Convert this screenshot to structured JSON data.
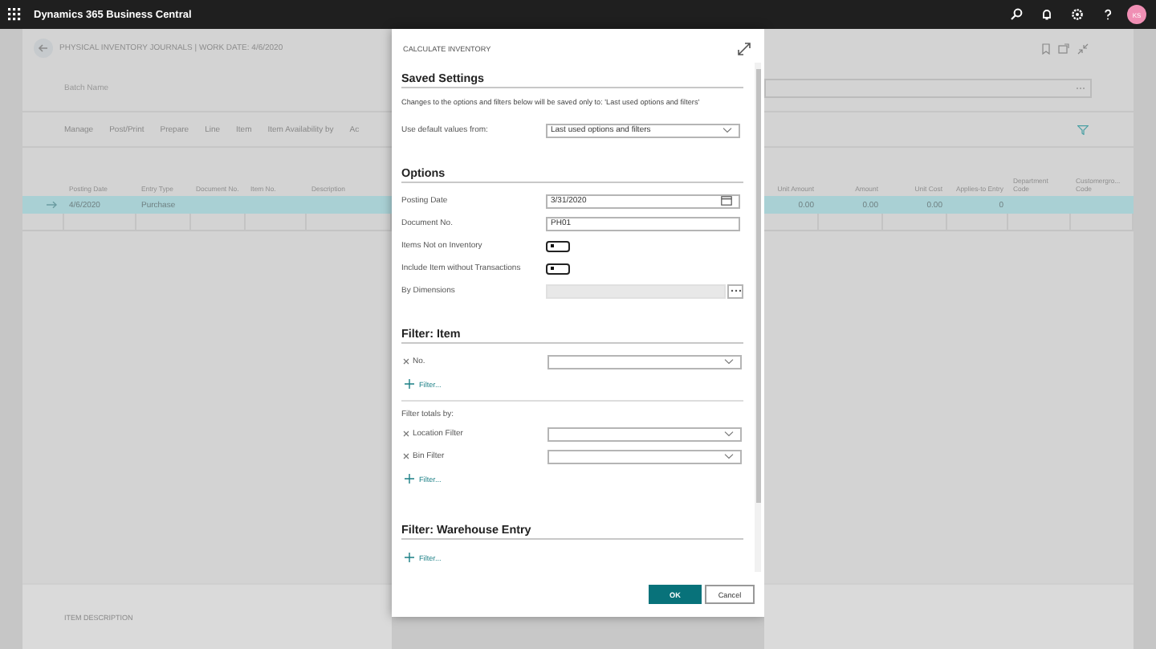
{
  "app": {
    "title": "Dynamics 365 Business Central",
    "avatar": "KS"
  },
  "page": {
    "title": "PHYSICAL INVENTORY JOURNALS | WORK DATE: 4/6/2020",
    "batch_label": "Batch Name",
    "actions": [
      "Manage",
      "Post/Print",
      "Prepare",
      "Line",
      "Item",
      "Item Availability by",
      "Ac"
    ],
    "columns_left": [
      "Posting Date",
      "Entry Type",
      "Document No.",
      "Item No.",
      "Description"
    ],
    "columns_right": [
      "Unit Amount",
      "Amount",
      "Unit Cost",
      "Applies-to Entry",
      "Department Code",
      "Customergro... Code"
    ],
    "rows": [
      {
        "selected": true,
        "posting_date": "4/6/2020",
        "entry_type": "Purchase",
        "unit_amount": "0.00",
        "amount": "0.00",
        "unit_cost": "0.00",
        "applies_to_entry": "0"
      }
    ],
    "factbox_title": "ITEM DESCRIPTION"
  },
  "dialog": {
    "title": "CALCULATE INVENTORY",
    "sections": [
      {
        "heading": "Saved Settings",
        "items": [
          {
            "kind": "note",
            "text": "Changes to the options and filters below will be saved only to: 'Last used options and filters'"
          },
          {
            "kind": "select",
            "label": "Use default values from:",
            "value": "Last used options and filters"
          }
        ]
      },
      {
        "heading": "Options",
        "items": [
          {
            "kind": "date",
            "label": "Posting Date",
            "value": "3/31/2020"
          },
          {
            "kind": "text",
            "label": "Document No.",
            "value": "PH01"
          },
          {
            "kind": "toggle",
            "label": "Items Not on Inventory",
            "on": false
          },
          {
            "kind": "toggle",
            "label": "Include Item without Transactions",
            "on": false
          },
          {
            "kind": "lookup",
            "label": "By Dimensions"
          }
        ]
      },
      {
        "heading": "Filter: Item",
        "items": [
          {
            "kind": "filter",
            "label": "No."
          },
          {
            "kind": "add_filter",
            "label": "Filter..."
          },
          {
            "kind": "subheading",
            "text": "Filter totals by:"
          },
          {
            "kind": "filter",
            "label": "Location Filter"
          },
          {
            "kind": "filter",
            "label": "Bin Filter"
          },
          {
            "kind": "add_filter",
            "label": "Filter..."
          }
        ]
      },
      {
        "heading": "Filter: Warehouse Entry",
        "items": [
          {
            "kind": "add_filter",
            "label": "Filter..."
          }
        ]
      }
    ],
    "buttons": [
      {
        "label": "OK",
        "kind": "primary"
      },
      {
        "label": "Cancel",
        "kind": "secondary"
      }
    ]
  }
}
